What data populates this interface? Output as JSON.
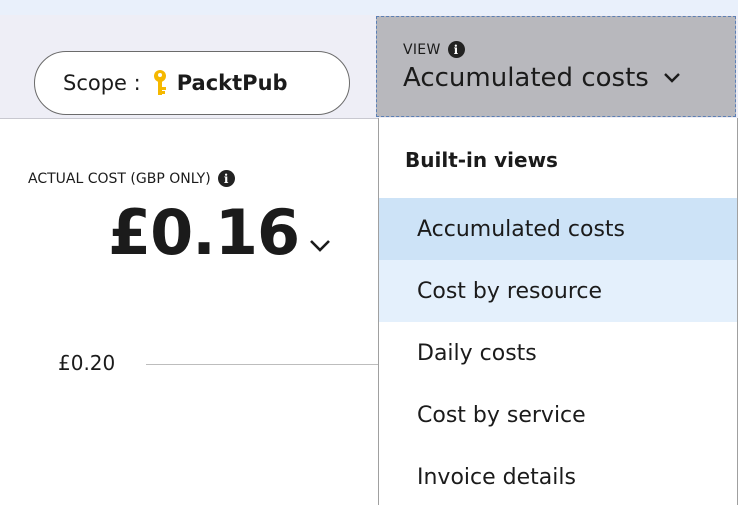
{
  "toolbar": {
    "scope_label": "Scope :",
    "scope_value": "PacktPub",
    "scope_icon": "key-icon",
    "view_caption": "VIEW",
    "view_value": "Accumulated costs"
  },
  "cost": {
    "label": "ACTUAL COST (GBP ONLY)",
    "amount": "£0.16"
  },
  "chart": {
    "tick": "£0.20"
  },
  "dropdown": {
    "heading": "Built-in views",
    "items": [
      {
        "label": "Accumulated costs"
      },
      {
        "label": "Cost by resource"
      },
      {
        "label": "Daily costs"
      },
      {
        "label": "Cost by service"
      },
      {
        "label": "Invoice details"
      }
    ]
  },
  "colors": {
    "selected_item": "#cde3f7",
    "hover_item": "#e4f0fc",
    "key_icon": "#f5b800",
    "view_button": "#b8b8bd"
  }
}
